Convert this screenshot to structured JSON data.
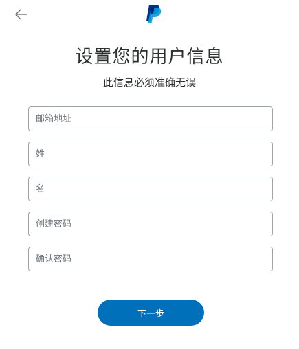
{
  "header": {
    "back_icon": "arrow-left-icon",
    "logo_icon": "paypal-logo-icon",
    "brand_color": "#0070ba"
  },
  "title": "设置您的用户信息",
  "subtitle": "此信息必须准确无误",
  "form": {
    "email_placeholder": "邮箱地址",
    "last_name_placeholder": "姓",
    "first_name_placeholder": "名",
    "password_placeholder": "创建密码",
    "confirm_password_placeholder": "确认密码",
    "email_value": "",
    "last_name_value": "",
    "first_name_value": "",
    "password_value": "",
    "confirm_password_value": ""
  },
  "next_label": "下一步"
}
